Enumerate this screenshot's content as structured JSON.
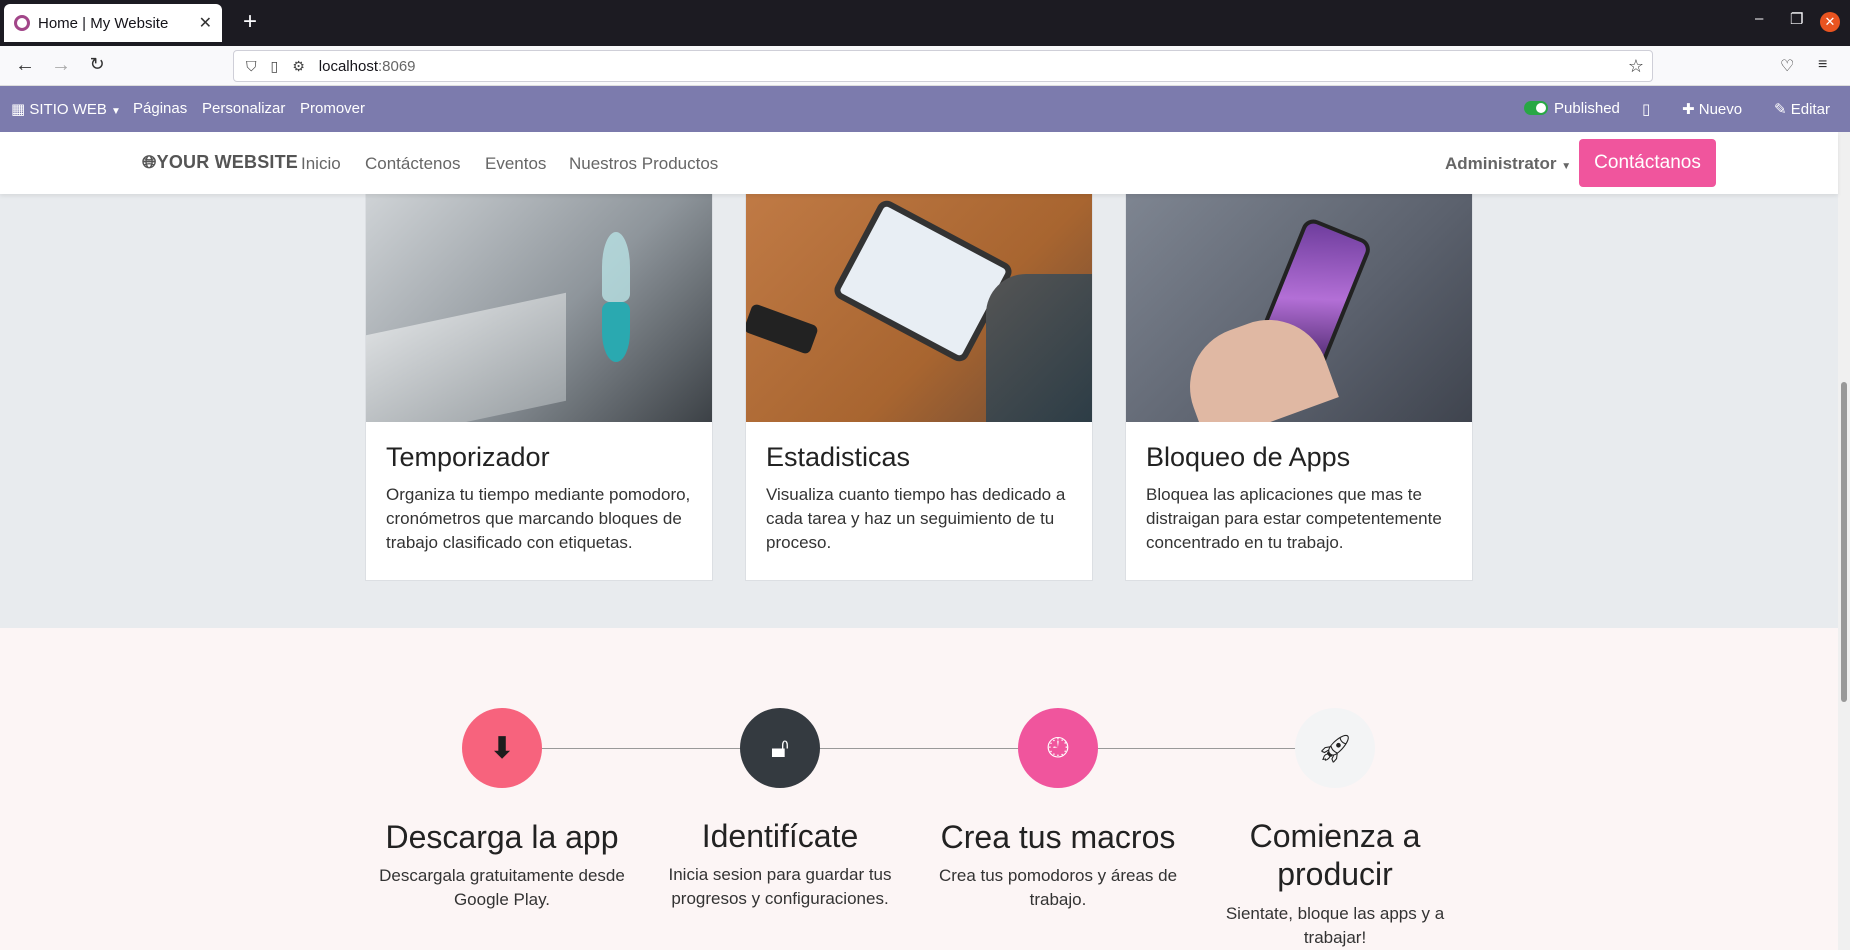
{
  "browser": {
    "tab_title": "Home | My Website",
    "new_tab": "+",
    "url_host": "localhost",
    "url_port": ":8069"
  },
  "adminbar": {
    "site_menu": "SITIO WEB",
    "pages": "Páginas",
    "customize": "Personalizar",
    "promote": "Promover",
    "published": "Published",
    "new": "Nuevo",
    "edit": "Editar"
  },
  "header": {
    "logo": "YOUR WEBSITE",
    "menu": [
      "Inicio",
      "Contáctenos",
      "Eventos",
      "Nuestros Productos"
    ],
    "user": "Administrator",
    "cta": "Contáctanos"
  },
  "cards": [
    {
      "title": "Temporizador",
      "text": "Organiza tu tiempo mediante pomodoro, cronómetros que marcando bloques de trabajo clasificado con etiquetas."
    },
    {
      "title": "Estadisticas",
      "text": "Visualiza cuanto tiempo has dedicado a cada tarea y haz un seguimiento de tu proceso."
    },
    {
      "title": "Bloqueo de Apps",
      "text": "Bloquea las aplicaciones que mas te distraigan para estar competentemente concentrado en tu trabajo."
    }
  ],
  "steps": [
    {
      "title": "Descarga la app",
      "text": "Descargala gratuitamente desde Google Play.",
      "icon": "download-icon",
      "color": "#f7637d"
    },
    {
      "title": "Identifícate",
      "text": "Inicia sesion para guardar tus progresos y configuraciones.",
      "icon": "unlock-icon",
      "color": "#343a40"
    },
    {
      "title": "Crea tus macros",
      "text": "Crea tus pomodoros y áreas de trabajo.",
      "icon": "clock-icon",
      "color": "#f0559d"
    },
    {
      "title": "Comienza a producir",
      "text": "Sientate, bloque las apps y a trabajar!",
      "icon": "rocket-icon",
      "color": "#f3f4f5"
    }
  ],
  "colors": {
    "admin_bar": "#7c7bad",
    "accent_pink": "#f0559d",
    "gray_section": "#e8ebee",
    "pink_section": "#fcf5f5"
  }
}
